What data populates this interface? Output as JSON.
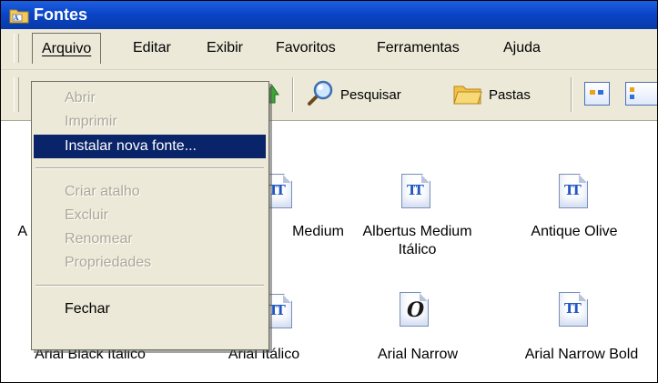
{
  "window": {
    "title": "Fontes"
  },
  "menubar": {
    "items": [
      "Arquivo",
      "Editar",
      "Exibir",
      "Favoritos",
      "Ferramentas",
      "Ajuda"
    ]
  },
  "toolbar": {
    "search_label": "Pesquisar",
    "folders_label": "Pastas"
  },
  "file_menu": {
    "items": [
      {
        "label": "Abrir",
        "enabled": false
      },
      {
        "label": "Imprimir",
        "enabled": false
      },
      {
        "label": "Instalar nova fonte...",
        "enabled": true,
        "selected": true
      },
      {
        "label": "Criar atalho",
        "enabled": false
      },
      {
        "label": "Excluir",
        "enabled": false
      },
      {
        "label": "Renomear",
        "enabled": false
      },
      {
        "label": "Propriedades",
        "enabled": false
      },
      {
        "label": "Fechar",
        "enabled": true
      }
    ]
  },
  "files": [
    {
      "name": "A",
      "icon": "truetype-font-icon"
    },
    {
      "name": "Medium",
      "icon": "truetype-font-icon"
    },
    {
      "name": "Albertus Medium Itálico",
      "icon": "truetype-font-icon"
    },
    {
      "name": "Antique Olive",
      "icon": "truetype-font-icon"
    },
    {
      "name": "Arial Black Itálico",
      "icon": "truetype-font-icon"
    },
    {
      "name": "Arial Itálico",
      "icon": "truetype-font-icon"
    },
    {
      "name": "Arial Narrow",
      "icon": "opentype-font-icon"
    },
    {
      "name": "Arial Narrow Bold",
      "icon": "truetype-font-icon"
    }
  ],
  "colors": {
    "title_bar": "#0a45c8",
    "menu_highlight": "#0a246a",
    "chrome": "#ece9d8"
  }
}
